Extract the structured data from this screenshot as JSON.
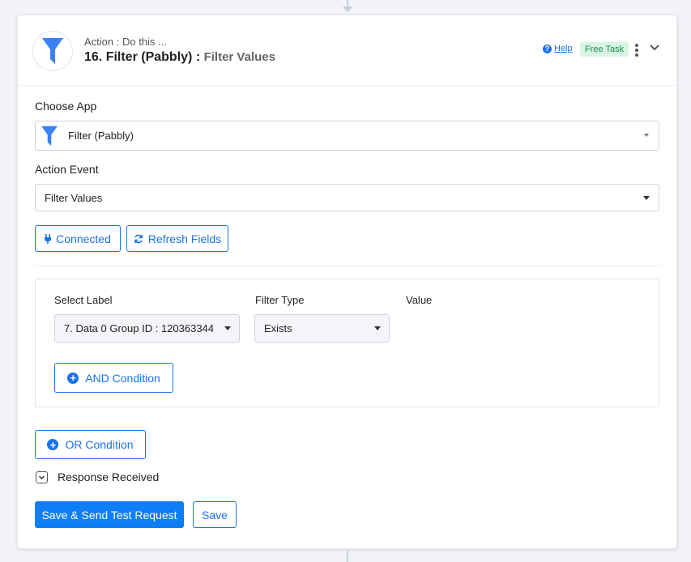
{
  "header": {
    "subtitle": "Action : Do this ...",
    "title": "16. Filter (Pabbly) :",
    "event": "Filter Values",
    "help_label": "Help",
    "badge": "Free Task"
  },
  "choose_app": {
    "label": "Choose App",
    "value": "Filter (Pabbly)"
  },
  "action_event": {
    "label": "Action Event",
    "value": "Filter Values"
  },
  "buttons": {
    "connected": "Connected",
    "refresh": "Refresh Fields",
    "and_condition": "AND Condition",
    "or_condition": "OR Condition",
    "save_test": "Save & Send Test Request",
    "save": "Save"
  },
  "filter": {
    "select_label_header": "Select Label",
    "filter_type_header": "Filter Type",
    "value_header": "Value",
    "select_label_value": "7. Data 0 Group ID : 120363344",
    "filter_type_value": "Exists"
  },
  "response": {
    "label": "Response Received"
  },
  "colors": {
    "accent": "#1a73e8",
    "primary_button": "#0d7ef5",
    "badge_bg": "#d8f5e4",
    "badge_text": "#1e8b4c",
    "funnel": "#3b82f6"
  },
  "icons": {
    "app": "funnel-icon",
    "help": "question-circle-icon",
    "menu": "kebab-menu-icon",
    "collapse": "chevron-down-icon",
    "connected": "plug-icon",
    "refresh": "refresh-icon",
    "add": "plus-circle-icon"
  }
}
